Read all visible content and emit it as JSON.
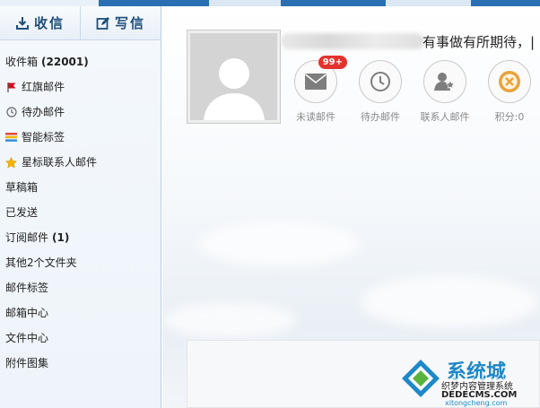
{
  "toolbar": {
    "receive_label": "收信",
    "compose_label": "写信"
  },
  "sidebar": {
    "items": [
      {
        "label": "收件箱",
        "count": "(22001)",
        "icon": ""
      },
      {
        "label": "红旗邮件",
        "count": "",
        "icon": "red-flag-icon"
      },
      {
        "label": "待办邮件",
        "count": "",
        "icon": "clock-icon"
      },
      {
        "label": "智能标签",
        "count": "",
        "icon": "color-tags-icon"
      },
      {
        "label": "星标联系人邮件",
        "count": "",
        "icon": "star-icon"
      },
      {
        "label": "草稿箱",
        "count": "",
        "icon": ""
      },
      {
        "label": "已发送",
        "count": "",
        "icon": ""
      },
      {
        "label": "订阅邮件",
        "count": "(1)",
        "icon": ""
      },
      {
        "label": "其他2个文件夹",
        "count": "",
        "icon": ""
      },
      {
        "label": "邮件标签",
        "count": "",
        "icon": ""
      },
      {
        "label": "邮箱中心",
        "count": "",
        "icon": ""
      },
      {
        "label": "文件中心",
        "count": "",
        "icon": ""
      },
      {
        "label": "附件图集",
        "count": "",
        "icon": ""
      }
    ]
  },
  "profile": {
    "slogan": "有事做有所期待，|",
    "avatar_icon": "default-user-avatar"
  },
  "quick": [
    {
      "label": "未读邮件",
      "badge": "99+",
      "icon": "envelope-icon"
    },
    {
      "label": "待办邮件",
      "badge": "",
      "icon": "clock-icon"
    },
    {
      "label": "联系人邮件",
      "badge": "",
      "icon": "contact-star-icon"
    },
    {
      "label": "积分:0",
      "badge": "",
      "icon": "points-coin-icon"
    }
  ],
  "watermark": {
    "brand": "系统城",
    "line1": "织梦内容管理系统",
    "line2": "DEDECMS.COM",
    "url": "xitongcheng.com"
  },
  "colors": {
    "accent": "#1f4e7a",
    "top_bar": "#2b6fb3",
    "badge": "#e2332e",
    "flag": "#d0111b",
    "star": "#f5b400",
    "coin": "#e8a33a"
  }
}
